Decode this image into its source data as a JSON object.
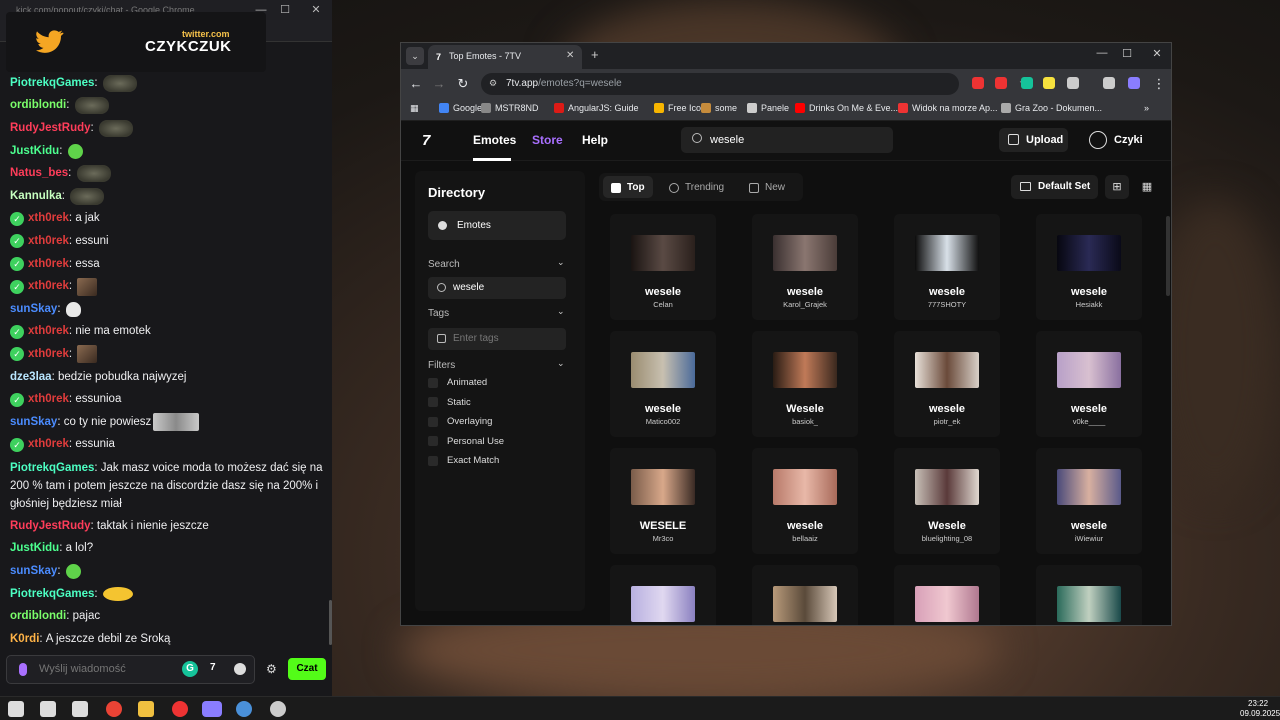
{
  "chat_window": {
    "title": "kick.com/popout/czyki/chat - Google Chrome",
    "overlay": {
      "twitter_small": "twitter.com",
      "twitter_big": "CZYKCZUK"
    },
    "messages": [
      {
        "user": "PiotrekqGames",
        "color": "#4cffc3",
        "text": "",
        "emote": "grey"
      },
      {
        "user": "ordiblondi",
        "color": "#7bff6b",
        "text": "",
        "emote": "grey"
      },
      {
        "user": "RudyJestRudy",
        "color": "#ff3d5a",
        "text": "",
        "emote": "grey"
      },
      {
        "user": "JustKidu",
        "color": "#4cff8f",
        "text": "",
        "emote": "green"
      },
      {
        "user": "Natus_bes",
        "color": "#ff3d5a",
        "text": "",
        "emote": "grey"
      },
      {
        "user": "Kannulka",
        "color": "#c6ffc0",
        "text": "",
        "emote": "grey"
      },
      {
        "user": "xth0rek",
        "color": "#e03c3c",
        "badge": true,
        "text": "a jak",
        "emote": ""
      },
      {
        "user": "xth0rek",
        "color": "#e03c3c",
        "badge": true,
        "text": "essuni",
        "emote": ""
      },
      {
        "user": "xth0rek",
        "color": "#e03c3c",
        "badge": true,
        "text": "essa",
        "emote": ""
      },
      {
        "user": "xth0rek",
        "color": "#e03c3c",
        "badge": true,
        "text": "",
        "emote": "photo"
      },
      {
        "user": "sunSkay",
        "color": "#4b8cff",
        "text": "",
        "emote": "skull"
      },
      {
        "user": "xth0rek",
        "color": "#e03c3c",
        "badge": true,
        "text": "nie ma emotek",
        "emote": ""
      },
      {
        "user": "xth0rek",
        "color": "#e03c3c",
        "badge": true,
        "text": "",
        "emote": "photo"
      },
      {
        "user": "dze3laa",
        "color": "#b9e6ff",
        "text": "bedzie pobudka najwyzej",
        "emote": ""
      },
      {
        "user": "xth0rek",
        "color": "#e03c3c",
        "badge": true,
        "text": "essunioa",
        "emote": ""
      },
      {
        "user": "sunSkay",
        "color": "#4b8cff",
        "text": "co ty nie powiesz",
        "emote": "eyes"
      },
      {
        "user": "xth0rek",
        "color": "#e03c3c",
        "badge": true,
        "text": "essunia",
        "emote": ""
      },
      {
        "user": "PiotrekqGames",
        "color": "#4cffc3",
        "text": "Jak masz voice moda to możesz dać się na 200 % tam i potem jeszcze na discordzie dasz się na 200% i głośniej będziesz miał",
        "emote": "",
        "multi": true
      },
      {
        "user": "RudyJestRudy",
        "color": "#ff3d5a",
        "text": "taktak i nienie jeszcze",
        "emote": ""
      },
      {
        "user": "JustKidu",
        "color": "#4cff8f",
        "text": "a lol?",
        "emote": ""
      },
      {
        "user": "sunSkay",
        "color": "#4b8cff",
        "text": "",
        "emote": "green"
      },
      {
        "user": "PiotrekqGames",
        "color": "#4cffc3",
        "text": "",
        "emote": "shades"
      },
      {
        "user": "ordiblondi",
        "color": "#7bff6b",
        "text": "pajac",
        "emote": ""
      },
      {
        "user": "K0rdi",
        "color": "#ffb347",
        "text": "A jeszcze debil ze Sroką",
        "emote": ""
      }
    ],
    "input_placeholder": "Wyślij wiadomość",
    "send_label": "Czat",
    "grammarly_label": "G",
    "seventv_label": "7",
    "settings_glyph": "⚙"
  },
  "browser": {
    "tab_title": "Top Emotes - 7TV",
    "tab_favicon": "7",
    "url_host": "7tv.app",
    "url_path": "/emotes?q=wesele",
    "bookmarks": [
      "Google",
      "MSTR8ND",
      "AngularJS: Guide",
      "Free Icons",
      "some",
      "Panele",
      "Drinks On Me & Eve...",
      "Widok na morze Ap...",
      "Gra Zoo - Dokumen..."
    ],
    "bookmark_colors": [
      "#4285f4",
      "#888",
      "#dd1b16",
      "#f7b500",
      "#c58b3c",
      "#ccc",
      "#ff0000",
      "#e33",
      "#aaa"
    ],
    "extension_colors": [
      "#e33",
      "#e33",
      "#15c39a",
      "#f7e23e",
      "#ccc",
      "#ccc",
      "#8a7dff"
    ]
  },
  "page": {
    "logo": "7",
    "nav": {
      "emotes": "Emotes",
      "store": "Store",
      "help": "Help"
    },
    "store_color": "#a970ff",
    "search_value": "wesele",
    "upload_label": "Upload",
    "user_name": "Czyki",
    "sidebar": {
      "title": "Directory",
      "emotes_label": "Emotes",
      "search_label": "Search",
      "search_value": "wesele",
      "tags_label": "Tags",
      "tags_placeholder": "Enter tags",
      "filters_label": "Filters",
      "filters": [
        "Animated",
        "Static",
        "Overlaying",
        "Personal Use",
        "Exact Match"
      ]
    },
    "tabs": {
      "top": "Top",
      "trending": "Trending",
      "new": "New"
    },
    "default_set_label": "Default Set",
    "emotes": [
      {
        "name": "wesele",
        "author": "Celan",
        "thumb": "linear-gradient(90deg,#1a1412,#5a4a44,#2a201c)"
      },
      {
        "name": "wesele",
        "author": "Karol_Grajek",
        "thumb": "linear-gradient(90deg,#3a3030,#8a7670,#4a3c38)"
      },
      {
        "name": "wesele",
        "author": "777SHOTY",
        "thumb": "linear-gradient(90deg,#0c0c0c,#d8e0e8,#101010)"
      },
      {
        "name": "wesele",
        "author": "Hesiakk",
        "thumb": "linear-gradient(90deg,#070710,#2a2a55,#0a0a18)"
      },
      {
        "name": "wesele",
        "author": "Matico002",
        "thumb": "linear-gradient(90deg,#9a8c70,#c8c0b0,#4a6a9a)"
      },
      {
        "name": "Wesele",
        "author": "basiok_",
        "thumb": "linear-gradient(90deg,#2a1c14,#c07a58,#3a281e)"
      },
      {
        "name": "wesele",
        "author": "piotr_ek",
        "thumb": "linear-gradient(90deg,#e8e0d8,#6a4a3a,#d8d0c8)"
      },
      {
        "name": "wesele",
        "author": "v0ke____",
        "thumb": "linear-gradient(90deg,#b8a0c8,#d8c0d0,#8a70a0)"
      },
      {
        "name": "WESELE",
        "author": "Mr3co",
        "thumb": "linear-gradient(90deg,#7a5c4a,#d8a88a,#3a2a24)"
      },
      {
        "name": "wesele",
        "author": "bellaaiz",
        "thumb": "linear-gradient(90deg,#b87a6a,#e8b8a8,#a86a5a)"
      },
      {
        "name": "Wesele",
        "author": "bluelighting_08",
        "thumb": "linear-gradient(90deg,#c8c0b8,#5a3a3a,#e0d8d0)"
      },
      {
        "name": "wesele",
        "author": "iWiewiur",
        "thumb": "linear-gradient(90deg,#4a4a7a,#d8b0a0,#5a5a8a)"
      },
      {
        "name": "",
        "author": "",
        "thumb": "linear-gradient(90deg,#b8b0e0,#e0d8f0,#8a80c0)"
      },
      {
        "name": "",
        "author": "",
        "thumb": "linear-gradient(90deg,#b89a7a,#5a4a3a,#d8c8b8)"
      },
      {
        "name": "",
        "author": "",
        "thumb": "linear-gradient(90deg,#d8a0b8,#f0c8d0,#b07890)"
      },
      {
        "name": "",
        "author": "",
        "thumb": "linear-gradient(90deg,#2a6a5a,#c0d0c0,#1a4a4a)"
      }
    ]
  },
  "taskbar": {
    "time": "23:22",
    "date": "09.09.2025",
    "icon_colors": [
      "#ddd",
      "#ddd",
      "#ddd",
      "#ea4335",
      "#f0c040",
      "#e33",
      "#8a7dff",
      "#4a90d9",
      "#ccc"
    ]
  }
}
